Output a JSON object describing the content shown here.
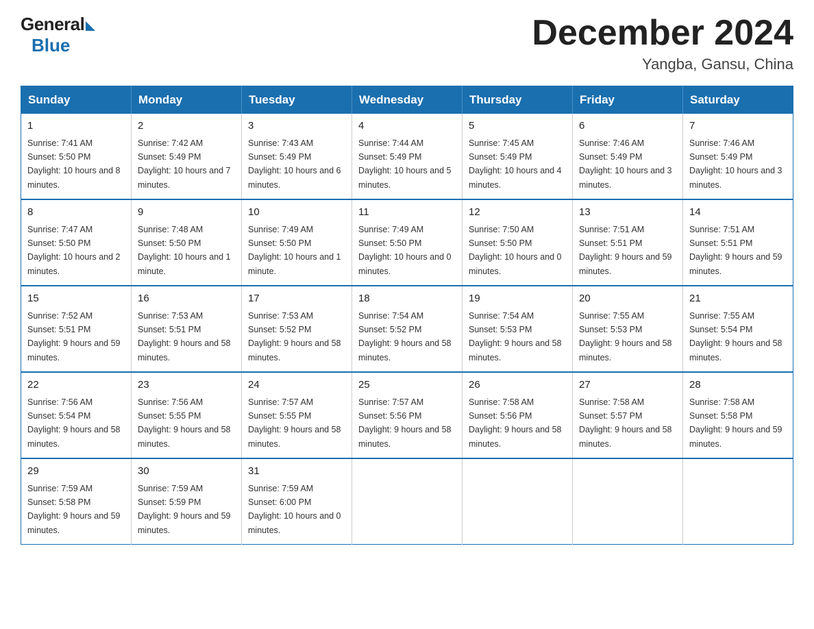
{
  "logo": {
    "general": "General",
    "blue": "Blue"
  },
  "title": "December 2024",
  "subtitle": "Yangba, Gansu, China",
  "days_of_week": [
    "Sunday",
    "Monday",
    "Tuesday",
    "Wednesday",
    "Thursday",
    "Friday",
    "Saturday"
  ],
  "weeks": [
    [
      {
        "day": "1",
        "sunrise": "7:41 AM",
        "sunset": "5:50 PM",
        "daylight": "10 hours and 8 minutes."
      },
      {
        "day": "2",
        "sunrise": "7:42 AM",
        "sunset": "5:49 PM",
        "daylight": "10 hours and 7 minutes."
      },
      {
        "day": "3",
        "sunrise": "7:43 AM",
        "sunset": "5:49 PM",
        "daylight": "10 hours and 6 minutes."
      },
      {
        "day": "4",
        "sunrise": "7:44 AM",
        "sunset": "5:49 PM",
        "daylight": "10 hours and 5 minutes."
      },
      {
        "day": "5",
        "sunrise": "7:45 AM",
        "sunset": "5:49 PM",
        "daylight": "10 hours and 4 minutes."
      },
      {
        "day": "6",
        "sunrise": "7:46 AM",
        "sunset": "5:49 PM",
        "daylight": "10 hours and 3 minutes."
      },
      {
        "day": "7",
        "sunrise": "7:46 AM",
        "sunset": "5:49 PM",
        "daylight": "10 hours and 3 minutes."
      }
    ],
    [
      {
        "day": "8",
        "sunrise": "7:47 AM",
        "sunset": "5:50 PM",
        "daylight": "10 hours and 2 minutes."
      },
      {
        "day": "9",
        "sunrise": "7:48 AM",
        "sunset": "5:50 PM",
        "daylight": "10 hours and 1 minute."
      },
      {
        "day": "10",
        "sunrise": "7:49 AM",
        "sunset": "5:50 PM",
        "daylight": "10 hours and 1 minute."
      },
      {
        "day": "11",
        "sunrise": "7:49 AM",
        "sunset": "5:50 PM",
        "daylight": "10 hours and 0 minutes."
      },
      {
        "day": "12",
        "sunrise": "7:50 AM",
        "sunset": "5:50 PM",
        "daylight": "10 hours and 0 minutes."
      },
      {
        "day": "13",
        "sunrise": "7:51 AM",
        "sunset": "5:51 PM",
        "daylight": "9 hours and 59 minutes."
      },
      {
        "day": "14",
        "sunrise": "7:51 AM",
        "sunset": "5:51 PM",
        "daylight": "9 hours and 59 minutes."
      }
    ],
    [
      {
        "day": "15",
        "sunrise": "7:52 AM",
        "sunset": "5:51 PM",
        "daylight": "9 hours and 59 minutes."
      },
      {
        "day": "16",
        "sunrise": "7:53 AM",
        "sunset": "5:51 PM",
        "daylight": "9 hours and 58 minutes."
      },
      {
        "day": "17",
        "sunrise": "7:53 AM",
        "sunset": "5:52 PM",
        "daylight": "9 hours and 58 minutes."
      },
      {
        "day": "18",
        "sunrise": "7:54 AM",
        "sunset": "5:52 PM",
        "daylight": "9 hours and 58 minutes."
      },
      {
        "day": "19",
        "sunrise": "7:54 AM",
        "sunset": "5:53 PM",
        "daylight": "9 hours and 58 minutes."
      },
      {
        "day": "20",
        "sunrise": "7:55 AM",
        "sunset": "5:53 PM",
        "daylight": "9 hours and 58 minutes."
      },
      {
        "day": "21",
        "sunrise": "7:55 AM",
        "sunset": "5:54 PM",
        "daylight": "9 hours and 58 minutes."
      }
    ],
    [
      {
        "day": "22",
        "sunrise": "7:56 AM",
        "sunset": "5:54 PM",
        "daylight": "9 hours and 58 minutes."
      },
      {
        "day": "23",
        "sunrise": "7:56 AM",
        "sunset": "5:55 PM",
        "daylight": "9 hours and 58 minutes."
      },
      {
        "day": "24",
        "sunrise": "7:57 AM",
        "sunset": "5:55 PM",
        "daylight": "9 hours and 58 minutes."
      },
      {
        "day": "25",
        "sunrise": "7:57 AM",
        "sunset": "5:56 PM",
        "daylight": "9 hours and 58 minutes."
      },
      {
        "day": "26",
        "sunrise": "7:58 AM",
        "sunset": "5:56 PM",
        "daylight": "9 hours and 58 minutes."
      },
      {
        "day": "27",
        "sunrise": "7:58 AM",
        "sunset": "5:57 PM",
        "daylight": "9 hours and 58 minutes."
      },
      {
        "day": "28",
        "sunrise": "7:58 AM",
        "sunset": "5:58 PM",
        "daylight": "9 hours and 59 minutes."
      }
    ],
    [
      {
        "day": "29",
        "sunrise": "7:59 AM",
        "sunset": "5:58 PM",
        "daylight": "9 hours and 59 minutes."
      },
      {
        "day": "30",
        "sunrise": "7:59 AM",
        "sunset": "5:59 PM",
        "daylight": "9 hours and 59 minutes."
      },
      {
        "day": "31",
        "sunrise": "7:59 AM",
        "sunset": "6:00 PM",
        "daylight": "10 hours and 0 minutes."
      },
      null,
      null,
      null,
      null
    ]
  ],
  "labels": {
    "sunrise": "Sunrise:",
    "sunset": "Sunset:",
    "daylight": "Daylight:"
  }
}
